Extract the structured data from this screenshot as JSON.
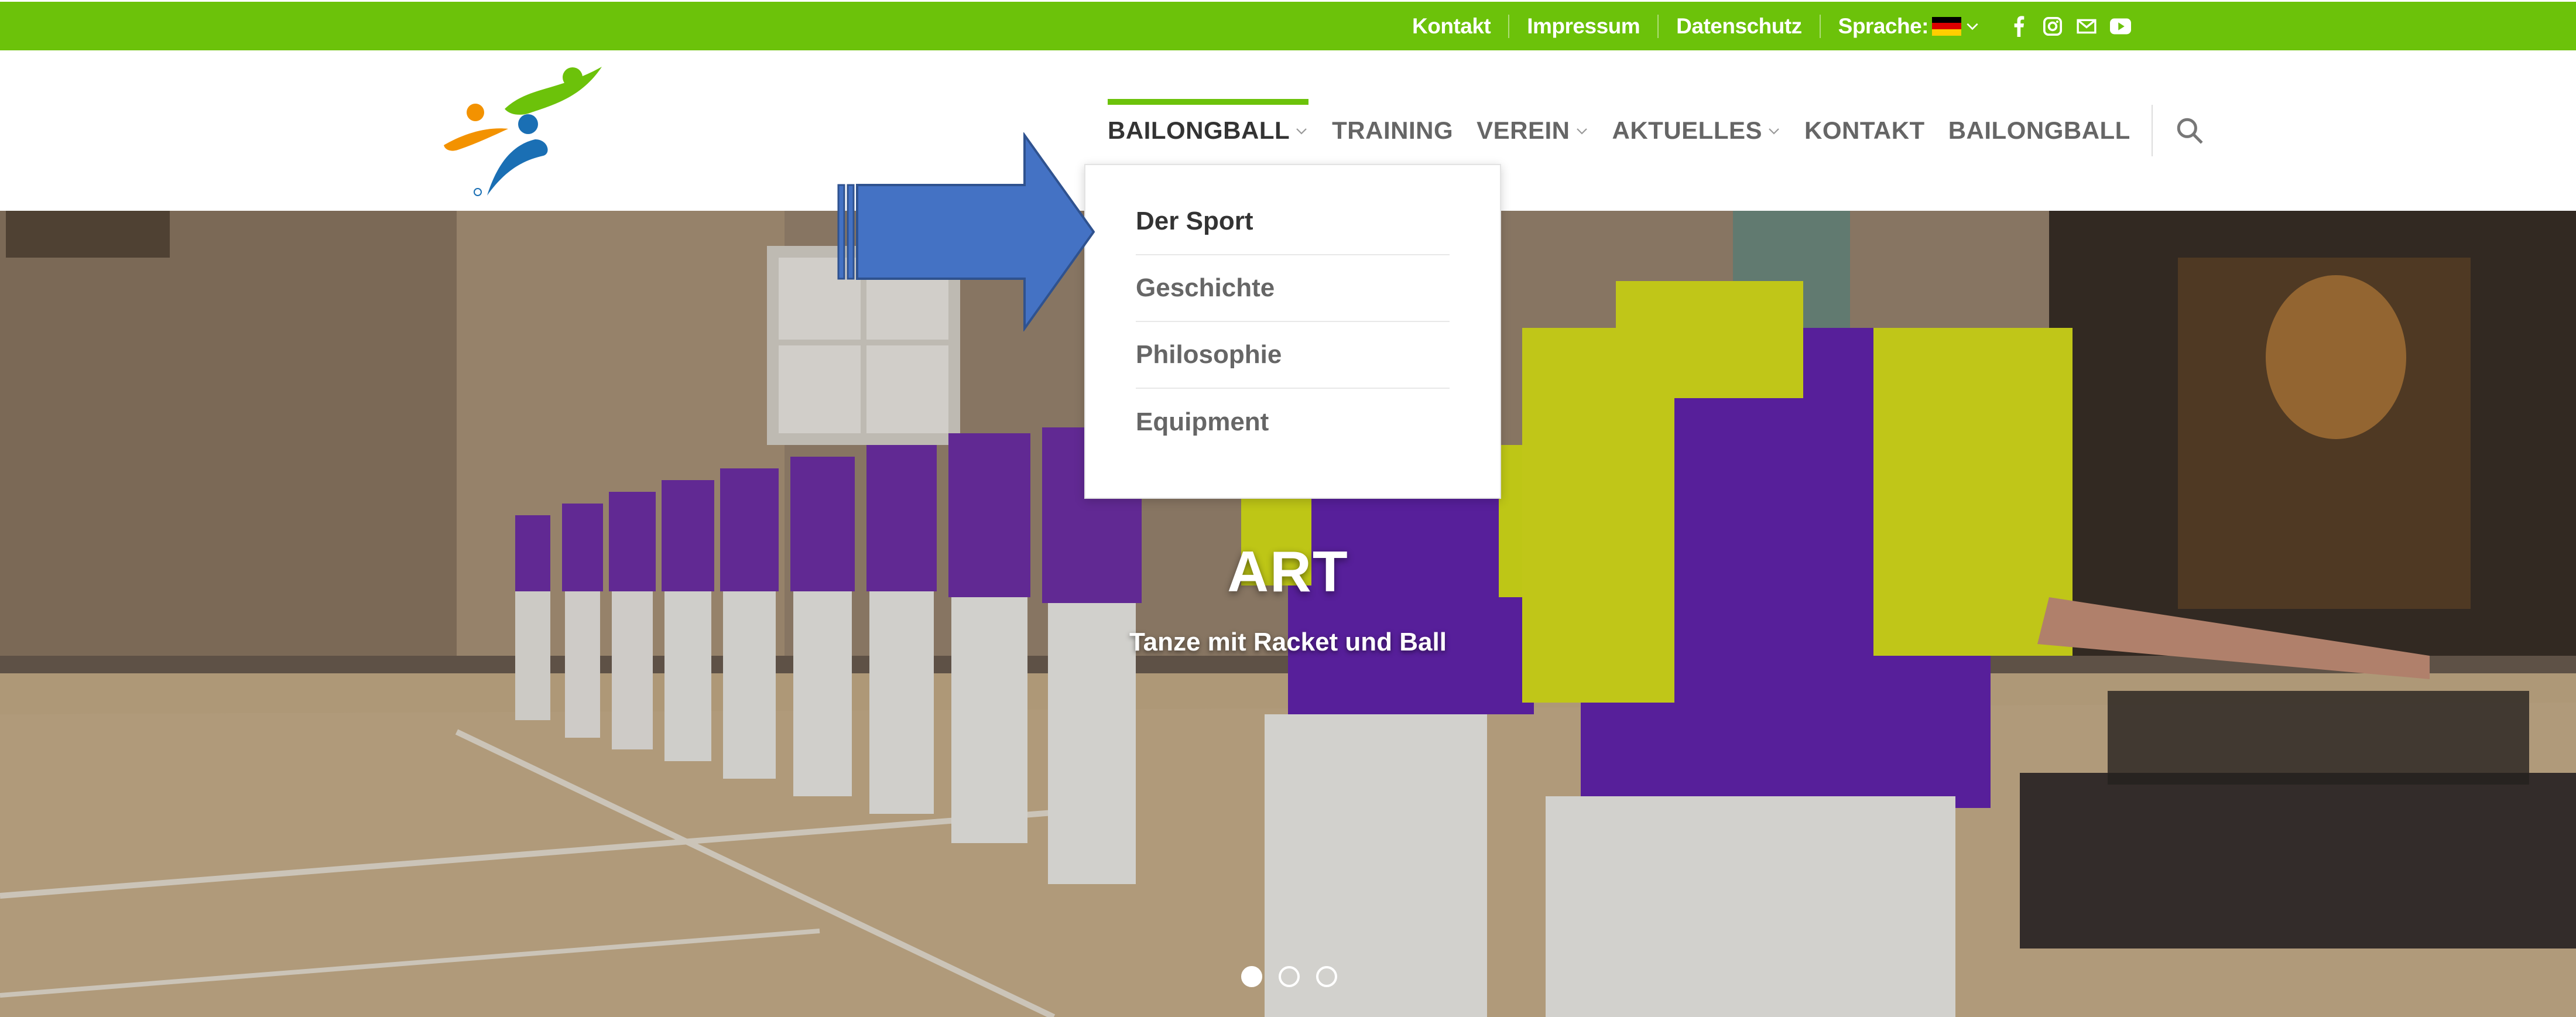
{
  "topbar": {
    "links": [
      {
        "label": "Kontakt"
      },
      {
        "label": "Impressum"
      },
      {
        "label": "Datenschutz"
      }
    ],
    "language_label": "Sprache:",
    "social_icons": [
      "facebook-icon",
      "instagram-icon",
      "mail-icon",
      "youtube-icon"
    ],
    "bg_color": "#6cc20a"
  },
  "nav": {
    "items": [
      {
        "label": "BAILONGBALL",
        "has_dropdown": true,
        "active": true
      },
      {
        "label": "TRAINING",
        "has_dropdown": false
      },
      {
        "label": "VEREIN",
        "has_dropdown": true
      },
      {
        "label": "AKTUELLES",
        "has_dropdown": true
      },
      {
        "label": "KONTAKT",
        "has_dropdown": false
      },
      {
        "label": "BAILONGBALL",
        "has_dropdown": false
      }
    ],
    "accent_color": "#6cc20a"
  },
  "dropdown": {
    "items": [
      {
        "label": "Der Sport"
      },
      {
        "label": "Geschichte"
      },
      {
        "label": "Philosophie"
      },
      {
        "label": "Equipment"
      }
    ]
  },
  "hero": {
    "title": "ART",
    "subtitle": "Tanze mit Racket und Ball",
    "slides": 3,
    "active_slide": 1
  }
}
